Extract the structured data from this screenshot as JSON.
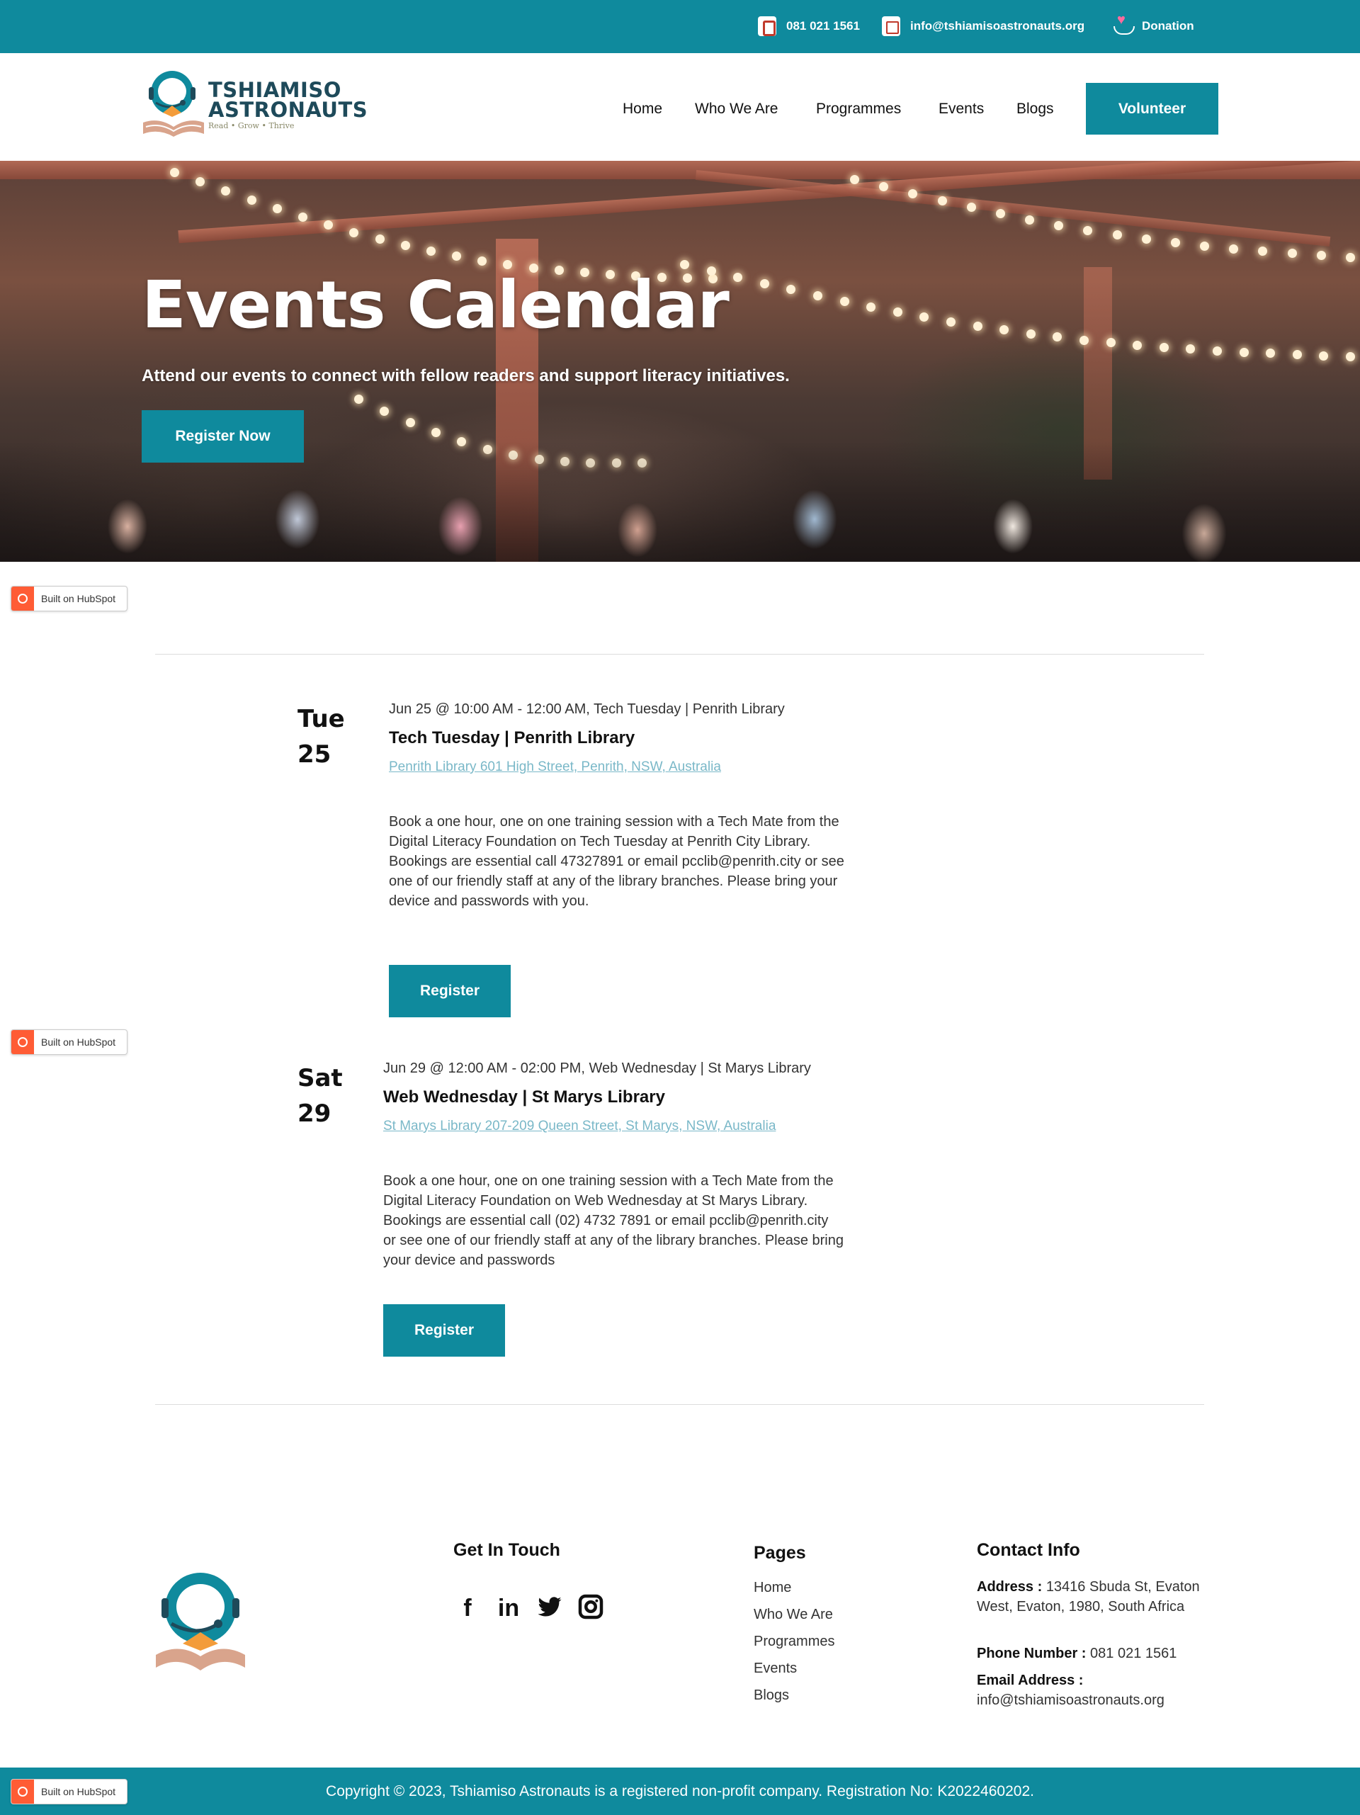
{
  "topbar": {
    "phone": "081 021 1561",
    "email": "info@tshiamisoastronauts.org",
    "donation": "Donation"
  },
  "brand": {
    "name_line1": "TSHIAMISO",
    "name_line2": "ASTRONAUTS",
    "tagline": "Read • Grow • Thrive",
    "primary_color": "#0f8a9d",
    "dark_color": "#1e4a5a"
  },
  "nav": {
    "items": [
      "Home",
      "Who We Are",
      "Programmes",
      "Events",
      "Blogs"
    ],
    "cta": "Volunteer"
  },
  "hero": {
    "title": "Events Calendar",
    "subtitle": "Attend our events to connect with fellow readers and support literacy initiatives.",
    "button": "Register Now"
  },
  "hubspot": {
    "label": "Built on HubSpot"
  },
  "events": [
    {
      "weekday": "Tue",
      "day": "25",
      "meta": "Jun 25 @ 10:00 AM - 12:00 AM, Tech Tuesday | Penrith Library",
      "title": "Tech Tuesday | Penrith Library",
      "location": "Penrith Library 601 High Street, Penrith, NSW, Australia",
      "description": "Book a one hour, one on one training session with a Tech Mate from the Digital Literacy Foundation on Tech Tuesday at Penrith City Library. Bookings are essential call 47327891 or email pcclib@penrith.city or see one of our friendly staff at any of the library branches. Please bring your device and passwords with you.",
      "button": "Register"
    },
    {
      "weekday": "Sat",
      "day": "29",
      "meta": "Jun 29 @ 12:00 AM - 02:00 PM, Web Wednesday | St Marys Library",
      "title": "Web Wednesday | St Marys Library",
      "location": "St Marys Library 207-209 Queen Street, St Marys, NSW, Australia",
      "description": "Book a one hour, one on one training session with a Tech Mate from the Digital Literacy Foundation on Web Wednesday at St Marys Library. Bookings are essential call (02) 4732 7891 or email pcclib@penrith.city or see one of our friendly staff at any of the library branches. Please bring your device and passwords",
      "button": "Register"
    }
  ],
  "footer": {
    "get_in_touch": "Get In Touch",
    "social_icons": [
      "facebook-icon",
      "linkedin-icon",
      "twitter-icon",
      "instagram-icon"
    ],
    "pages_heading": "Pages",
    "pages": [
      "Home",
      "Who We Are",
      "Programmes",
      "Events",
      "Blogs"
    ],
    "contact_heading": "Contact Info",
    "address_label": "Address :",
    "address": "13416 Sbuda St, Evaton West, Evaton, 1980, South Africa",
    "phone_label": "Phone Number :",
    "phone": "081 021 1561",
    "email_label": "Email Address :",
    "email": "info@tshiamisoastronauts.org",
    "copyright": "Copyright © 2023, Tshiamiso Astronauts is a registered non-profit company. Registration No: K2022460202."
  }
}
